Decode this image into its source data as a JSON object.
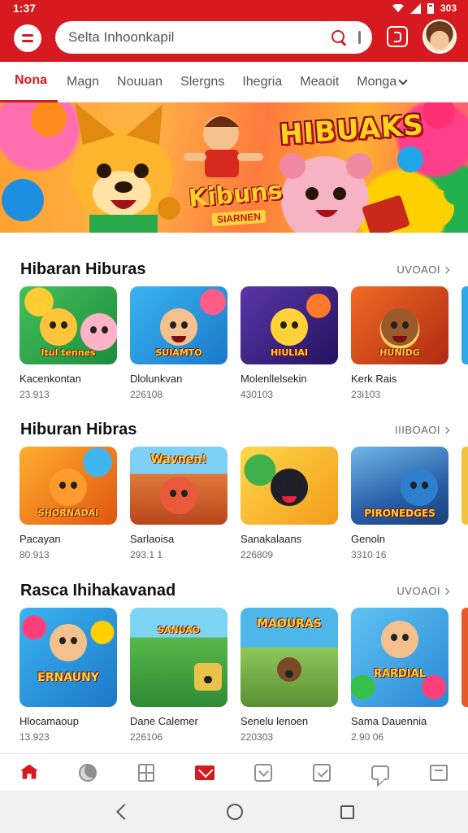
{
  "status_bar": {
    "time": "1:37",
    "battery_text": "303"
  },
  "search": {
    "placeholder": "Selta Inhoonkapil"
  },
  "tabs": [
    {
      "label": "Nona",
      "active": true
    },
    {
      "label": "Magn",
      "active": false
    },
    {
      "label": "Nouuan",
      "active": false
    },
    {
      "label": "Slergns",
      "active": false
    },
    {
      "label": "Ihegria",
      "active": false
    },
    {
      "label": "Meaoit",
      "active": false
    },
    {
      "label": "Monga",
      "active": false
    }
  ],
  "banner": {
    "title": "HIBUAKS",
    "subtitle": "Kibuns",
    "tag": "SIARNEN"
  },
  "sections": [
    {
      "title": "Hibaran Hiburas",
      "see_all": "UVOAOI",
      "items": [
        {
          "title": "Kacenkontan",
          "meta": "23.913",
          "caption": "Itul tennes",
          "bg": "#2fa84f"
        },
        {
          "title": "Dlolunkvan",
          "meta": "226108",
          "caption": "SUIAMTO",
          "bg": "#2b9be0"
        },
        {
          "title": "Molenllelsekin",
          "meta": "430103",
          "caption": "HIULIAI",
          "bg": "#4a2a8c"
        },
        {
          "title": "Kerk Rais",
          "meta": "23i103",
          "caption": "HUNIDG",
          "bg": "#d5461b"
        }
      ]
    },
    {
      "title": "Hiburan Hibras",
      "see_all": "IIIBOAOI",
      "items": [
        {
          "title": "Pacayan",
          "meta": "80.913",
          "caption": "SHORNADAI",
          "bg": "#ff8a1c"
        },
        {
          "title": "Sarlaoisa",
          "meta": "293.1 1",
          "caption": "Wavnen!",
          "bg": "#e0663a"
        },
        {
          "title": "Sanakalaans",
          "meta": "226809",
          "caption": "",
          "bg": "#f0c531"
        },
        {
          "title": "Genoln",
          "meta": "3310 16",
          "caption": "PIRONEDGES",
          "bg": "#2b6fbd"
        }
      ]
    },
    {
      "title": "Rasca Ihihakavanad",
      "see_all": "UVOAOI",
      "items": [
        {
          "title": "Hlocamaoup",
          "meta": "13.923",
          "caption": "ERNAUNY",
          "bg": "#2aa3e6"
        },
        {
          "title": "Dane Calemer",
          "meta": "226106",
          "caption": "SANUAO",
          "bg": "#3fa34a"
        },
        {
          "title": "Senelu lenoen",
          "meta": "220303",
          "caption": "MAOURAS",
          "bg": "#2f8fd1"
        },
        {
          "title": "Sama Dauennia",
          "meta": "2.90 06",
          "caption": "RARDIAL",
          "bg": "#4fb4ef"
        }
      ]
    }
  ],
  "bottom_nav": [
    "home-icon",
    "globe-icon",
    "grid-icon",
    "mail-icon",
    "box-icon",
    "check-icon",
    "chat-icon",
    "inbox-icon"
  ],
  "colors": {
    "primary": "#d71920",
    "nav_inactive": "#8f8f8f"
  }
}
